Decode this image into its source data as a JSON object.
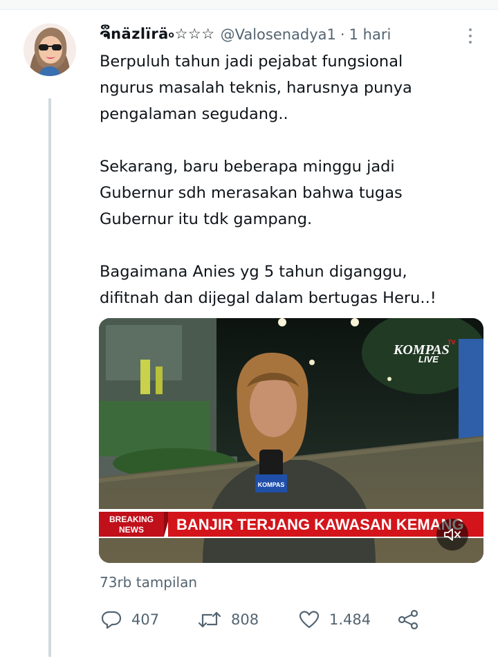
{
  "tweet": {
    "display_name": "ຈຶnäzlïrä৹☆☆☆",
    "handle": "@Valosenadya1",
    "separator": "·",
    "time": "1 hari",
    "paragraphs": [
      [
        "Berpuluh tahun jadi pejabat fungsional",
        "ngurus masalah teknis, harusnya punya",
        "pengalaman segudang.."
      ],
      [
        "Sekarang, baru beberapa minggu jadi",
        "Gubernur sdh merasakan bahwa tugas",
        "Gubernur itu tdk gampang."
      ],
      [
        "Bagaimana Anies yg 5 tahun diganggu,",
        "difitnah dan dijegal dalam bertugas Heru..!"
      ]
    ],
    "views": "73rb tampilan"
  },
  "media": {
    "channel_logo": "KOMPAS",
    "channel_tv": "TV",
    "channel_live": "LIVE",
    "mic_label": "KOMPAS",
    "breaking_label_1": "BREAKING",
    "breaking_label_2": "NEWS",
    "headline": "BANJIR TERJANG KAWASAN KEMANG"
  },
  "actions": {
    "replies": "407",
    "retweets": "808",
    "likes": "1.484"
  },
  "icons": {
    "more": "more-vertical-icon",
    "reply": "reply-icon",
    "retweet": "retweet-icon",
    "like": "heart-icon",
    "share": "share-icon",
    "mute": "volume-muted-icon"
  },
  "colors": {
    "text": "#0f1419",
    "secondary": "#536471",
    "thread_line": "#cfd9de",
    "breaking_red": "#d3151b"
  }
}
